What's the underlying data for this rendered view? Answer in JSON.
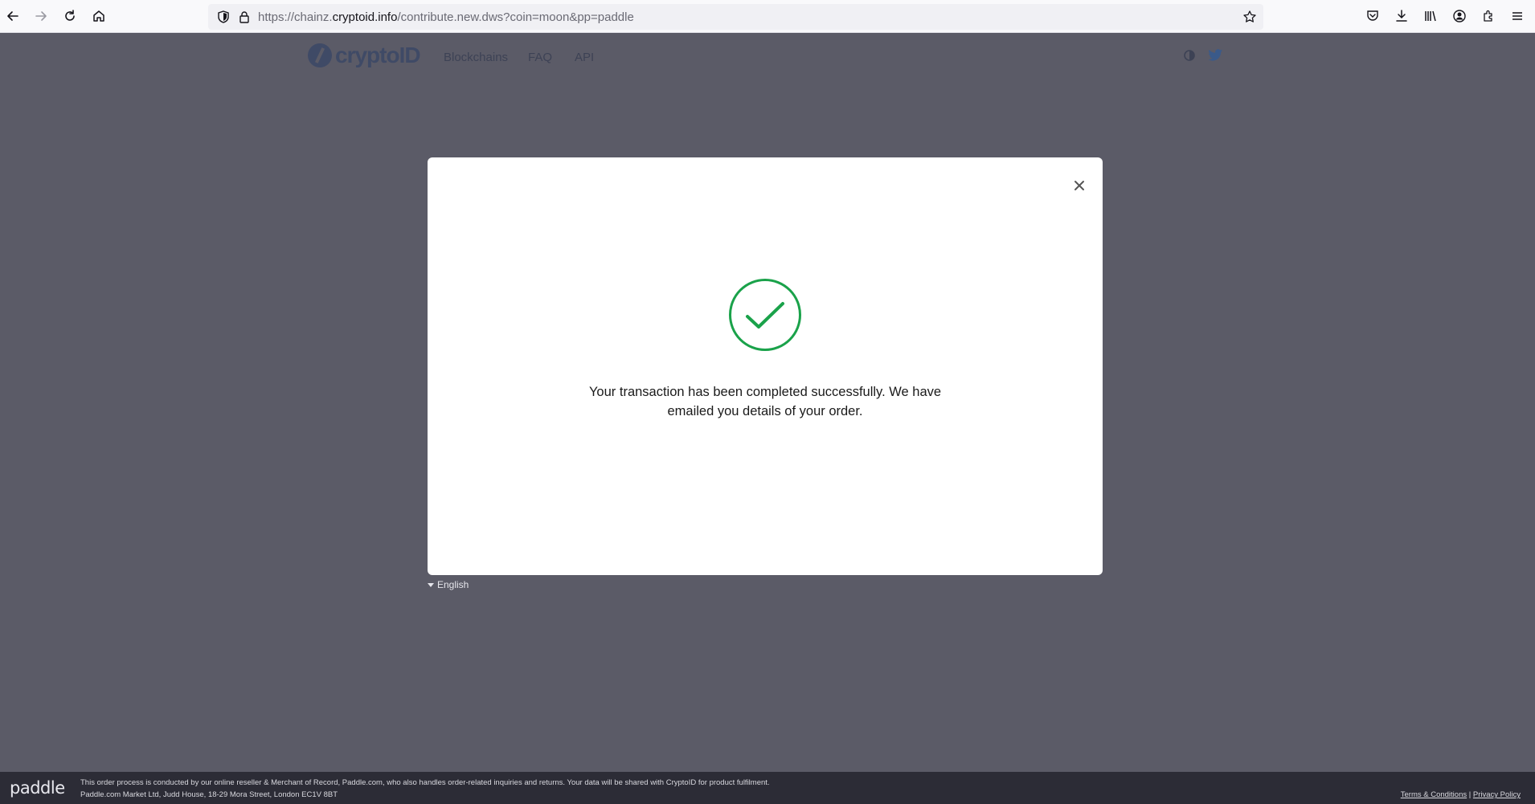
{
  "browser": {
    "url_prefix": "https://chainz.",
    "url_host": "cryptoid.info",
    "url_path": "/contribute.new.dws?coin=moon&pp=paddle"
  },
  "site": {
    "logo_text": "cryptoID",
    "nav": [
      "Blockchains",
      "FAQ",
      "API"
    ]
  },
  "modal": {
    "close_label": "×",
    "message": "Your transaction has been completed successfully. We have emailed you details of your order.",
    "accent_color": "#1aa24a"
  },
  "language": {
    "selected": "English"
  },
  "footer": {
    "logo": "paddle",
    "line1": "This order process is conducted by our online reseller & Merchant of Record, Paddle.com, who also handles order-related inquiries and returns.  Your data will be shared with CryptoID for product fulfilment.",
    "line2": "Paddle.com Market Ltd, Judd House, 18-29 Mora Street, London EC1V 8BT",
    "terms": "Terms & Conditions",
    "separator": "|",
    "privacy": "Privacy Policy"
  }
}
